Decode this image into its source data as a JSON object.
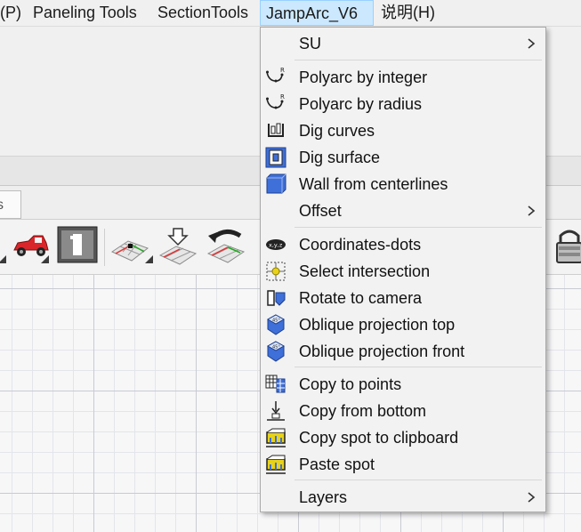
{
  "menubar": {
    "items": [
      "(P)",
      "Paneling Tools",
      "SectionTools",
      "JampArc_V6",
      "说明(H)"
    ],
    "active_index": 3
  },
  "background": {
    "tab_stub": "s"
  },
  "menu": {
    "items": [
      {
        "label": "SU",
        "icon": "none",
        "submenu": true
      },
      {
        "label": "Polyarc by integer",
        "icon": "polyarc-icon",
        "submenu": false
      },
      {
        "label": "Polyarc by radius",
        "icon": "polyarc-icon",
        "submenu": false
      },
      {
        "label": "Dig curves",
        "icon": "dig-curves-icon",
        "submenu": false
      },
      {
        "label": "Dig surface",
        "icon": "dig-surface-icon",
        "submenu": false
      },
      {
        "label": "Wall from centerlines",
        "icon": "wall-icon",
        "submenu": false
      },
      {
        "label": "Offset",
        "icon": "none",
        "submenu": true
      },
      {
        "label": "Coordinates-dots",
        "icon": "coordinates-dots-icon",
        "submenu": false
      },
      {
        "label": "Select intersection",
        "icon": "select-intersection-icon",
        "submenu": false
      },
      {
        "label": "Rotate to camera",
        "icon": "rotate-to-camera-icon",
        "submenu": false
      },
      {
        "label": "Oblique projection top",
        "icon": "oblique-projection-icon",
        "submenu": false
      },
      {
        "label": "Oblique projection front",
        "icon": "oblique-projection-icon",
        "submenu": false
      },
      {
        "label": "Copy to points",
        "icon": "copy-to-points-icon",
        "submenu": false
      },
      {
        "label": "Copy from bottom",
        "icon": "copy-from-bottom-icon",
        "submenu": false
      },
      {
        "label": "Copy spot to clipboard",
        "icon": "copy-spot-icon",
        "submenu": false
      },
      {
        "label": "Paste spot",
        "icon": "paste-spot-icon",
        "submenu": false
      },
      {
        "label": "Layers",
        "icon": "none",
        "submenu": true
      }
    ]
  },
  "toolbar": {
    "icons": [
      "car-icon",
      "viewport-1-icon",
      "plane-point-icon",
      "plane-arrow-icon",
      "rotate-plane-icon",
      "lock-icon"
    ]
  },
  "colors": {
    "menu_highlight": "#cce8ff",
    "menu_highlight_border": "#99d1ff",
    "icon_blue": "#3f6fd8",
    "icon_yellow": "#e8d21a",
    "car_red": "#d9262b"
  }
}
